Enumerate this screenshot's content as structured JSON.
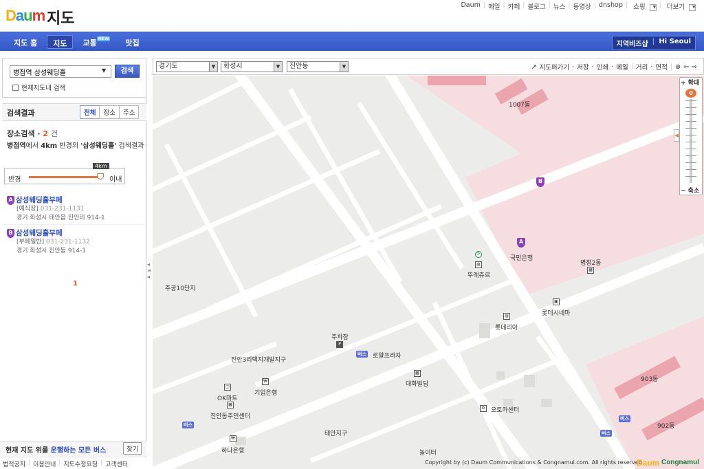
{
  "header": {
    "logo": {
      "d": "D",
      "a": "a",
      "u": "u",
      "m": "m"
    },
    "title": "지도",
    "links": [
      "Daum",
      "메일",
      "카페",
      "블로그",
      "뉴스",
      "동영상",
      "dnshop",
      "쇼핑",
      "더보기"
    ]
  },
  "nav": {
    "tabs": [
      "지도 홈",
      "지도",
      "교통",
      "맛집"
    ],
    "new_badge": "NEW",
    "right": [
      "지역비즈샵",
      "Hi Seoul"
    ]
  },
  "search": {
    "value": "병점역 삼성웨딩홀",
    "button": "검색",
    "checkbox_label": "현재지도내 검색"
  },
  "results": {
    "title": "검색결과",
    "tabs": [
      "전체",
      "장소",
      "주소"
    ],
    "place_label": "장소검색",
    "count": "2",
    "count_unit": "건",
    "desc_origin": "병점역",
    "desc_mid1": "에서 ",
    "desc_radius": "4km",
    "desc_mid2": " 반경의 ",
    "desc_query": "'삼성웨딩홀'",
    "desc_tail": " 검색결과",
    "radius_label": "반경",
    "radius_value": "4km",
    "radius_unit": "이내",
    "items": [
      {
        "pin": "A",
        "name": "삼성웨딩홀부페",
        "cat": "[예식장]",
        "phone": "031-231-1131",
        "addr": "경기 화성시 태안읍 진안리 914-1"
      },
      {
        "pin": "B",
        "name": "삼성웨딩홀부페",
        "cat": "[부페일반]",
        "phone": "031-231-1132",
        "addr": "경기 화성시 진안동 914-1"
      }
    ],
    "page": "1"
  },
  "footer": {
    "bus_prefix": "현재 지도 위를 ",
    "bus_hl": "운행하는 모든 버스",
    "bus_btn": "찾기",
    "links": [
      "법적공지",
      "이용안내",
      "지도수정요청",
      "고객센터"
    ]
  },
  "mapbar": {
    "selects": [
      "경기도",
      "화성시",
      "진안동"
    ],
    "tools": [
      "지도퍼가기",
      "저장",
      "인쇄",
      "메일",
      "거리",
      "면적"
    ]
  },
  "zoom": {
    "in": "+ 확대",
    "out": "− 축소",
    "level": "0"
  },
  "map": {
    "labels": [
      "1007동",
      "국민은행",
      "병점2동",
      "뚜레쥬르",
      "주공10단지",
      "롯데시네마",
      "롯데리아",
      "주차장",
      "로얄프라자",
      "진안3리택지개발지구",
      "대화빌딩",
      "기업은행",
      "OK마트",
      "오토카센터",
      "진안동주민센터",
      "903동",
      "902동",
      "태안지구",
      "하나은행",
      "놀이터"
    ],
    "bus": "버스",
    "pin_a": "A",
    "pin_b": "B"
  },
  "copyright": "Copyright by (c) Daum Communications & Congnamul.com. All rights reserved",
  "copyright_logo": "Daum",
  "copyright_logo2": "Congnamul"
}
